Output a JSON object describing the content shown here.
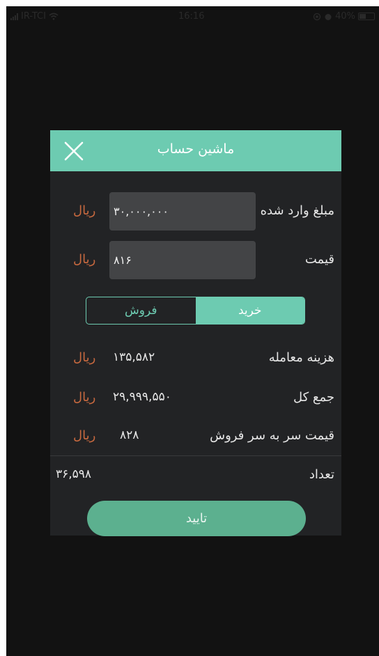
{
  "status_bar": {
    "carrier": "IR-TCI",
    "time": "16:16",
    "battery": "40%"
  },
  "dialog": {
    "title": "ماشین حساب",
    "close_icon": "close-icon",
    "amount": {
      "label": "مبلغ وارد شده",
      "value": "۳۰,۰۰۰,۰۰۰",
      "unit": "ریال"
    },
    "price": {
      "label": "قیمت",
      "value": "۸۱۶",
      "unit": "ریال"
    },
    "toggle": {
      "buy_label": "خرید",
      "sell_label": "فروش",
      "selected": "buy"
    },
    "fee": {
      "label": "هزینه معامله",
      "value": "۱۳۵,۵۸۲",
      "unit": "ریال"
    },
    "total": {
      "label": "جمع کل",
      "value": "۲۹,۹۹۹,۵۵۰",
      "unit": "ریال"
    },
    "breakeven": {
      "label": "قیمت سر به سر فروش",
      "value": "۸۲۸",
      "unit": "ریال"
    },
    "count": {
      "label": "تعداد",
      "value": "۳۶,۵۹۸"
    },
    "confirm_label": "تایید"
  },
  "colors": {
    "accent": "#6dcbb1",
    "unit": "#c8693f",
    "dialog_bg": "#222325",
    "screen_bg": "#121212"
  }
}
